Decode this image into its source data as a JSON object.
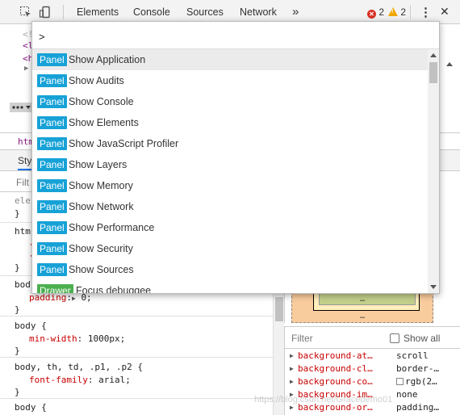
{
  "toolbar": {
    "tabs": [
      "Elements",
      "Console",
      "Sources",
      "Network"
    ],
    "more_label": "»",
    "error_count": "2",
    "warning_count": "2",
    "menu_glyph": "⋮",
    "close_glyph": "✕",
    "icons": [
      "inspect-element-icon",
      "device-toolbar-icon",
      "more-tabs-icon",
      "error-icon",
      "warning-icon",
      "kebab-menu-icon",
      "close-icon"
    ]
  },
  "background": {
    "dom_fragments": [
      "<!",
      "<l",
      "<h"
    ],
    "breadcrumb": "htm",
    "subtab": "Sty",
    "filter_fragment": "Filt"
  },
  "styles": {
    "rule1_selector": "ele",
    "rule2_selector": "htm",
    "rule3_selector": "bod",
    "rule3_prop": "padding",
    "rule3_value": "0;",
    "rule4_selector": "body {",
    "rule4_prop": "min-width",
    "rule4_value": "1000px;",
    "rule5_selector": "body, th, td, .p1, .p2 {",
    "rule5_prop": "font-family",
    "rule5_value": "arial;",
    "rule6_selector": "body {",
    "close_brace": "}"
  },
  "box_model": {
    "dash_top": "–",
    "dash_bottom": "–"
  },
  "computed": {
    "filter_label": "Filter",
    "show_all_label": "Show all",
    "rows": [
      {
        "name": "background-at…",
        "value": "scroll"
      },
      {
        "name": "background-cl…",
        "value": "border-…"
      },
      {
        "name": "background-co…",
        "value": "rgb(2…"
      },
      {
        "name": "background-im…",
        "value": "none"
      },
      {
        "name": "background-or…",
        "value": "padding…"
      }
    ]
  },
  "command_menu": {
    "input_value": ">",
    "items": [
      {
        "tag": "Panel",
        "label": "Show Application",
        "selected": true
      },
      {
        "tag": "Panel",
        "label": "Show Audits"
      },
      {
        "tag": "Panel",
        "label": "Show Console"
      },
      {
        "tag": "Panel",
        "label": "Show Elements"
      },
      {
        "tag": "Panel",
        "label": "Show JavaScript Profiler"
      },
      {
        "tag": "Panel",
        "label": "Show Layers"
      },
      {
        "tag": "Panel",
        "label": "Show Memory"
      },
      {
        "tag": "Panel",
        "label": "Show Network"
      },
      {
        "tag": "Panel",
        "label": "Show Performance"
      },
      {
        "tag": "Panel",
        "label": "Show Security"
      },
      {
        "tag": "Panel",
        "label": "Show Sources"
      },
      {
        "tag": "Drawer",
        "label": "Focus debuggee"
      }
    ]
  },
  "watermark": "https://blog.csdn.net/Gracedemo01",
  "colors": {
    "panel_tag": "#17a2d7",
    "drawer_tag": "#4caf50",
    "error": "#d93025",
    "warning": "#f2a600",
    "margin_box": "#f9cc9d"
  }
}
